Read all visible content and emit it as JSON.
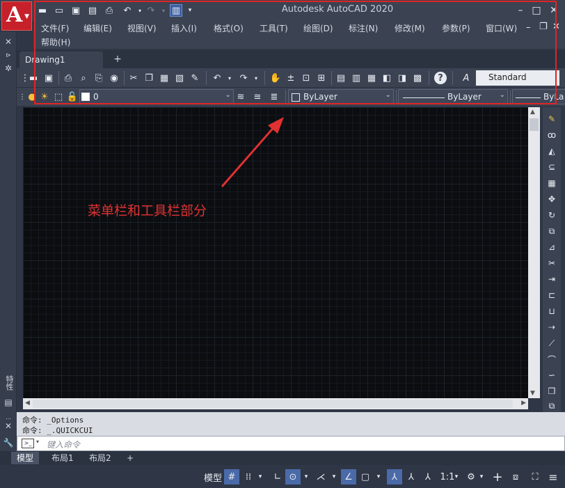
{
  "window": {
    "title": "Autodesk AutoCAD 2020",
    "app_letter": "A",
    "minimize": "–",
    "maximize": "□",
    "close": "✕"
  },
  "menu": {
    "items": [
      "文件(F)",
      "编辑(E)",
      "视图(V)",
      "插入(I)",
      "格式(O)",
      "工具(T)",
      "绘图(D)",
      "标注(N)",
      "修改(M)",
      "参数(P)",
      "窗口(W)"
    ],
    "second_row": [
      "帮助(H)"
    ],
    "doc_controls": [
      "–",
      "❐",
      "✕"
    ]
  },
  "tabs": {
    "active": "Drawing1",
    "add": "+"
  },
  "toolbar_standard": {
    "text_style": "Standard",
    "text_style_icon": "A"
  },
  "toolbar_layers": {
    "layer_name": "0",
    "color": "ByLayer",
    "linetype": "ByLayer",
    "lineweight": "ByLa"
  },
  "annotation": {
    "text": "菜单栏和工具栏部分",
    "color": "#e03131"
  },
  "command": {
    "history": [
      "命令: _Options",
      "命令: _.QUICKCUI"
    ],
    "placeholder": "键入命令"
  },
  "layout_tabs": [
    "模型",
    "布局1",
    "布局2",
    "+"
  ],
  "status": {
    "model_label": "模型",
    "scale": "1:1"
  },
  "side_panel": {
    "properties_label": "特性"
  },
  "colors": {
    "highlight": "#e02424",
    "logo": "#c6202a",
    "canvas": "#0b0d10",
    "chrome": "#3b4353"
  }
}
